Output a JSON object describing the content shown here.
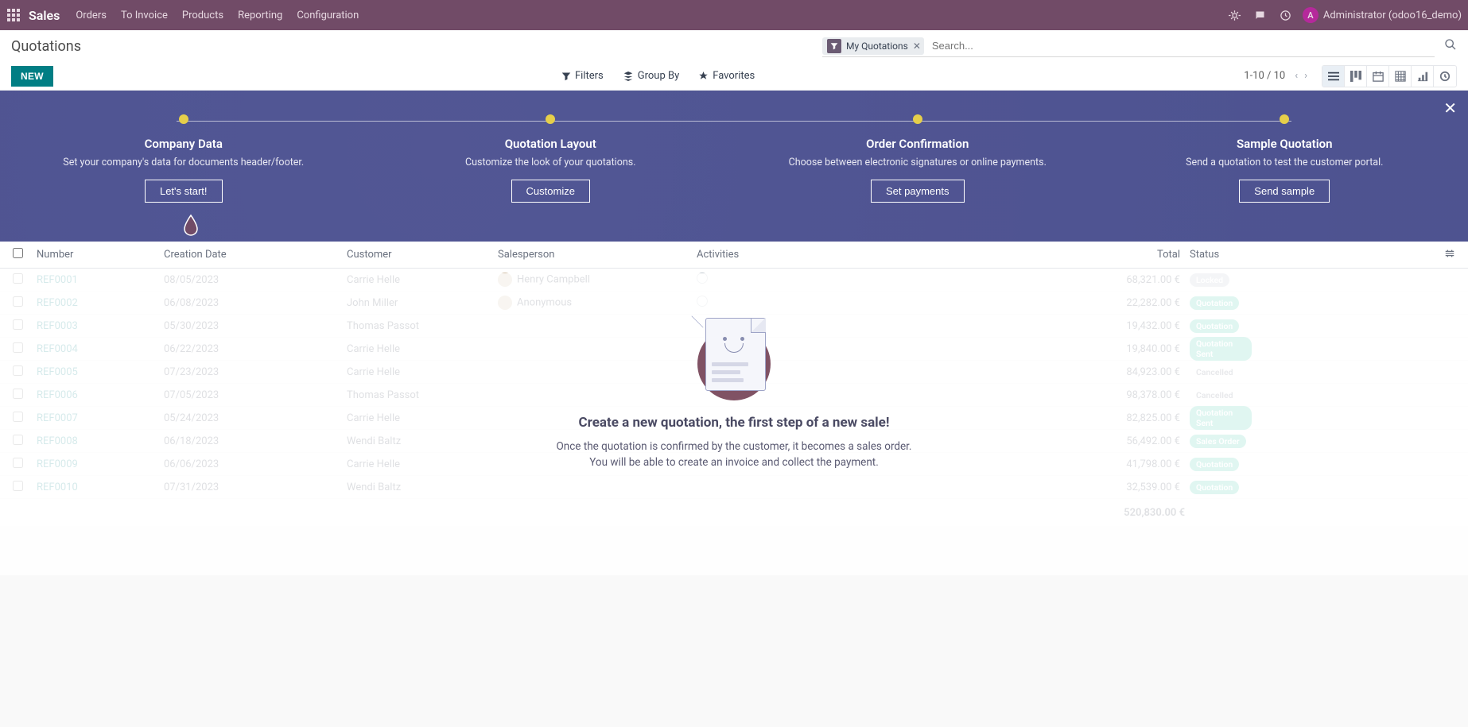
{
  "nav": {
    "brand": "Sales",
    "items": [
      "Orders",
      "To Invoice",
      "Products",
      "Reporting",
      "Configuration"
    ],
    "user_avatar_letter": "A",
    "user_label": "Administrator (odoo16_demo)"
  },
  "breadcrumb": "Quotations",
  "search": {
    "chip_label": "My Quotations",
    "placeholder": "Search..."
  },
  "toolbar": {
    "new_label": "NEW",
    "filters": "Filters",
    "group_by": "Group By",
    "favorites": "Favorites",
    "pager": "1-10 / 10"
  },
  "onboarding": {
    "steps": [
      {
        "title": "Company Data",
        "desc": "Set your company's data for documents header/footer.",
        "cta": "Let's start!"
      },
      {
        "title": "Quotation Layout",
        "desc": "Customize the look of your quotations.",
        "cta": "Customize"
      },
      {
        "title": "Order Confirmation",
        "desc": "Choose between electronic signatures or online payments.",
        "cta": "Set payments"
      },
      {
        "title": "Sample Quotation",
        "desc": "Send a quotation to test the customer portal.",
        "cta": "Send sample"
      }
    ]
  },
  "table": {
    "headers": {
      "number": "Number",
      "creation_date": "Creation Date",
      "customer": "Customer",
      "salesperson": "Salesperson",
      "activities": "Activities",
      "total": "Total",
      "status": "Status"
    },
    "rows": [
      {
        "number": "REF0001",
        "date": "08/05/2023",
        "customer": "Carrie Helle",
        "salesperson": "Henry Campbell",
        "activity": true,
        "total": "68,321.00 €",
        "status": "Locked",
        "badge": "gray"
      },
      {
        "number": "REF0002",
        "date": "06/08/2023",
        "customer": "John Miller",
        "salesperson": "Anonymous",
        "activity": true,
        "total": "22,282.00 €",
        "status": "Quotation",
        "badge": "teal"
      },
      {
        "number": "REF0003",
        "date": "05/30/2023",
        "customer": "Thomas Passot",
        "salesperson": "",
        "activity": false,
        "total": "19,432.00 €",
        "status": "Quotation",
        "badge": "teal"
      },
      {
        "number": "REF0004",
        "date": "06/22/2023",
        "customer": "Carrie Helle",
        "salesperson": "",
        "activity": false,
        "total": "19,840.00 €",
        "status": "Quotation Sent",
        "badge": "teal"
      },
      {
        "number": "REF0005",
        "date": "07/23/2023",
        "customer": "Carrie Helle",
        "salesperson": "",
        "activity": false,
        "total": "84,923.00 €",
        "status": "Cancelled",
        "badge": "none"
      },
      {
        "number": "REF0006",
        "date": "07/05/2023",
        "customer": "Thomas Passot",
        "salesperson": "",
        "activity": false,
        "total": "98,378.00 €",
        "status": "Cancelled",
        "badge": "none"
      },
      {
        "number": "REF0007",
        "date": "05/24/2023",
        "customer": "Carrie Helle",
        "salesperson": "",
        "activity": false,
        "total": "82,825.00 €",
        "status": "Quotation Sent",
        "badge": "teal"
      },
      {
        "number": "REF0008",
        "date": "06/18/2023",
        "customer": "Wendi Baltz",
        "salesperson": "",
        "activity": false,
        "total": "56,492.00 €",
        "status": "Sales Order",
        "badge": "teal"
      },
      {
        "number": "REF0009",
        "date": "06/06/2023",
        "customer": "Carrie Helle",
        "salesperson": "",
        "activity": false,
        "total": "41,798.00 €",
        "status": "Quotation",
        "badge": "teal"
      },
      {
        "number": "REF0010",
        "date": "07/31/2023",
        "customer": "Wendi Baltz",
        "salesperson": "",
        "activity": false,
        "total": "32,539.00 €",
        "status": "Quotation",
        "badge": "teal"
      }
    ],
    "footer_total": "520,830.00 €"
  },
  "empty": {
    "title": "Create a new quotation, the first step of a new sale!",
    "line1": "Once the quotation is confirmed by the customer, it becomes a sales order.",
    "line2": "You will be able to create an invoice and collect the payment."
  }
}
